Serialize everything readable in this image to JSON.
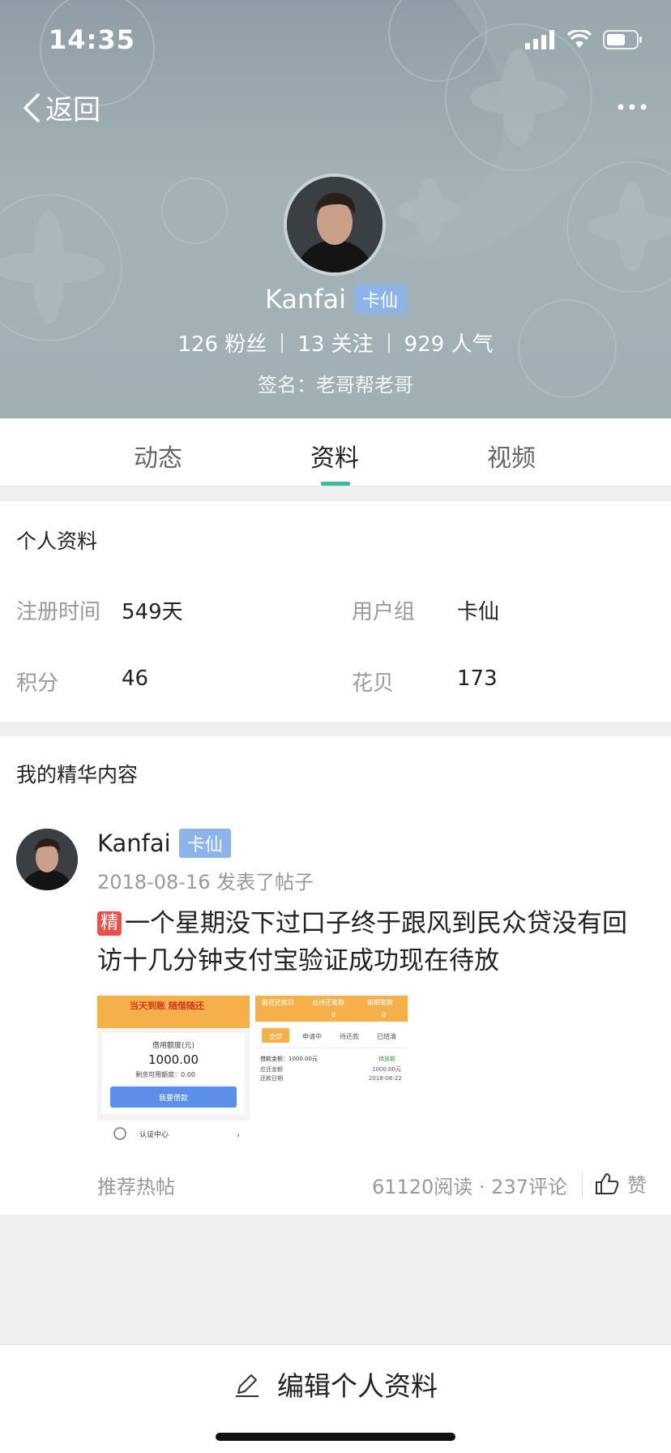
{
  "status_bar": {
    "time": "14:35"
  },
  "nav": {
    "back_label": "返回"
  },
  "profile": {
    "name": "Kanfai",
    "badge": "卡仙",
    "fans": "126 粉丝",
    "following": "13 关注",
    "popularity": "929 人气",
    "signature": "签名：老哥帮老哥"
  },
  "tabs": [
    {
      "label": "动态",
      "active": false
    },
    {
      "label": "资料",
      "active": true
    },
    {
      "label": "视频",
      "active": false
    }
  ],
  "personal_info": {
    "title": "个人资料",
    "fields": [
      {
        "label": "注册时间",
        "value": "549天"
      },
      {
        "label": "用户组",
        "value": "卡仙"
      },
      {
        "label": "积分",
        "value": "46"
      },
      {
        "label": "花贝",
        "value": "173"
      }
    ]
  },
  "featured": {
    "title": "我的精华内容",
    "post": {
      "author": "Kanfai",
      "badge": "卡仙",
      "meta": "2018-08-16 发表了帖子",
      "essence_tag": "精",
      "text": "一个星期没下过口子终于跟风到民众贷没有回访十几分钟支付宝验证成功现在待放",
      "thumb1": {
        "banner": "当天到账 随借随还",
        "amount_label": "借用额度(元)",
        "amount": "1000.00",
        "remaining": "剩余可用额度：0.00",
        "button": "我要借款",
        "auth": "认证中心"
      },
      "thumb2": {
        "header_left": "最近还款日",
        "header_mid": "总待还笔数",
        "header_right": "逾期笔数",
        "zero1": "0",
        "zero2": "0",
        "tabs": [
          "全部",
          "申请中",
          "待还款",
          "已结清"
        ],
        "row1_label": "借款金额：1000.00元",
        "row1_status": "待放款",
        "row2_label": "应还金额",
        "row2_value": "1000.00元",
        "row3_label": "还款日期",
        "row3_value": "2018-08-22"
      },
      "recommend": "推荐热帖",
      "counts": "61120阅读 · 237评论",
      "like_label": "赞"
    }
  },
  "bottom": {
    "edit_label": "编辑个人资料"
  },
  "colors": {
    "accent": "#3cb99a",
    "badge": "#8cb4e8",
    "essence": "#e8504a"
  }
}
